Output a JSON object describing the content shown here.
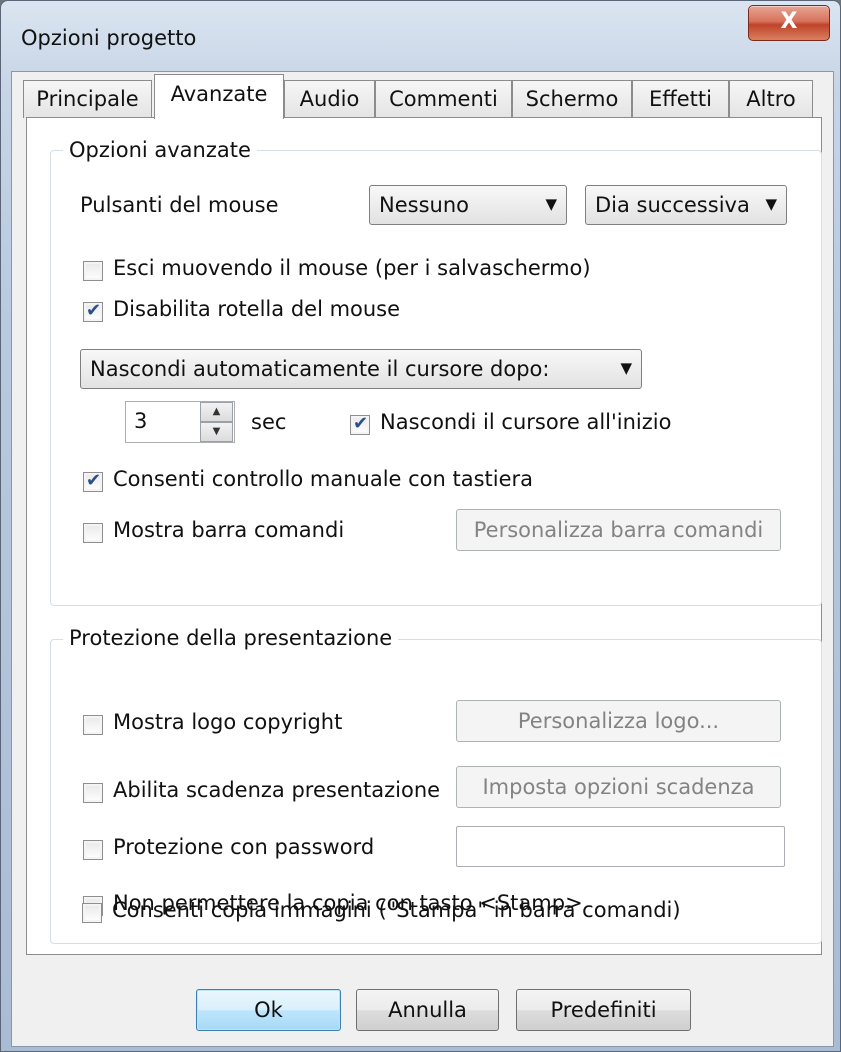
{
  "window": {
    "title": "Opzioni progetto",
    "close_label": "X"
  },
  "tabs": [
    {
      "label": "Principale",
      "active": false
    },
    {
      "label": "Avanzate",
      "active": true
    },
    {
      "label": "Audio",
      "active": false
    },
    {
      "label": "Commenti",
      "active": false
    },
    {
      "label": "Schermo",
      "active": false
    },
    {
      "label": "Effetti",
      "active": false
    },
    {
      "label": "Altro",
      "active": false
    }
  ],
  "advanced": {
    "legend": "Opzioni avanzate",
    "mouse_buttons_label": "Pulsanti del mouse",
    "mouse_button_1": "Nessuno",
    "mouse_button_2": "Dia successiva",
    "exit_on_mouse_move": {
      "label": "Esci muovendo il mouse (per i salvaschermo)",
      "checked": false
    },
    "disable_mouse_wheel": {
      "label": "Disabilita rotella del mouse",
      "checked": true
    },
    "cursor_hide_mode": "Nascondi automaticamente il cursore dopo:",
    "cursor_seconds": "3",
    "seconds_unit": "sec",
    "hide_cursor_at_start": {
      "label": "Nascondi il cursore all'inizio",
      "checked": true
    },
    "keyboard_control": {
      "label": "Consenti controllo manuale con tastiera",
      "checked": true
    },
    "show_command_bar": {
      "label": "Mostra barra comandi",
      "checked": false
    },
    "customize_command_bar": "Personalizza barra comandi"
  },
  "protection": {
    "legend": "Protezione della presentazione",
    "show_copyright_logo": {
      "label": "Mostra logo copyright",
      "checked": false
    },
    "customize_logo": "Personalizza logo...",
    "enable_expiration": {
      "label": "Abilita scadenza presentazione",
      "checked": false
    },
    "expiration_options": "Imposta opzioni scadenza",
    "password_protection": {
      "label": "Protezione con password",
      "checked": false
    },
    "password_value": "",
    "no_printscreen": {
      "label": "Non permettere la copia con tasto <Stamp>",
      "checked": false
    },
    "allow_image_copy": {
      "label": "Consenti copia immagini (\"Stampa\" in barra comandi)",
      "checked": false
    }
  },
  "footer": {
    "ok": "Ok",
    "cancel": "Annulla",
    "defaults": "Predefiniti"
  }
}
